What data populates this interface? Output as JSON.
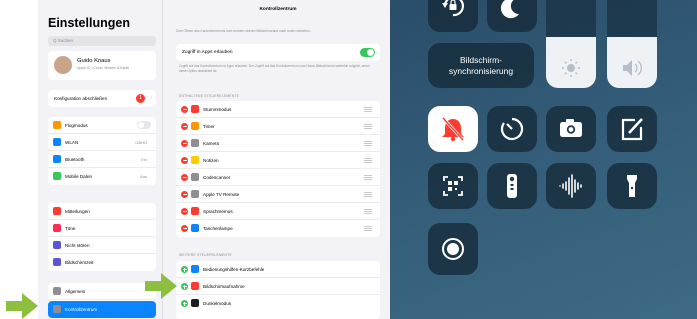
{
  "sidebar": {
    "title": "Einstellungen",
    "search_placeholder": "Q Suchen",
    "profile": {
      "name": "Guido Knaus",
      "subtitle": "Apple-ID, iCloud, Medien & Käufe"
    },
    "config": {
      "label": "Konfiguration abschließen",
      "badge": "1"
    },
    "group1": [
      {
        "label": "Flugmodus",
        "value": "",
        "color": "#ff9500"
      },
      {
        "label": "WLAN",
        "value": "GBHO",
        "color": "#0a84ff"
      },
      {
        "label": "Bluetooth",
        "value": "Ein",
        "color": "#0a84ff"
      },
      {
        "label": "Mobile Daten",
        "value": "Aus",
        "color": "#34c759"
      }
    ],
    "group2": [
      {
        "label": "Mitteilungen",
        "color": "#ff3b30"
      },
      {
        "label": "Töne",
        "color": "#ff2d55"
      },
      {
        "label": "Nicht stören",
        "color": "#5856d6"
      },
      {
        "label": "Bildschirmzeit",
        "color": "#5856d6"
      }
    ],
    "group3": [
      {
        "label": "Allgemein",
        "color": "#8e8e93"
      },
      {
        "label": "Kontrollzentrum",
        "color": "#8e8e93"
      }
    ]
  },
  "detail": {
    "title": "Kontrollzentrum",
    "description": "Zum Öffnen des Kontrollzentrums vom rechten oberen Bildschirmrand nach unten streichen.",
    "access_label": "Zugriff in Apps erlauben",
    "access_desc": "Zugriff auf das Kontrollzentrum in Apps erlauben. Der Zugriff auf das Kontrollzentrum vom Home-Bildschirm ist weiterhin möglich, wenn diese Option deaktiviert ist.",
    "included_header": "ENTHALTENE STEUERELEMENTE",
    "included": [
      {
        "label": "Stummmodus",
        "color": "#ff3b30"
      },
      {
        "label": "Timer",
        "color": "#ff9500"
      },
      {
        "label": "Kamera",
        "color": "#8e8e93"
      },
      {
        "label": "Notizen",
        "color": "#ffcc00"
      },
      {
        "label": "Codescanner",
        "color": "#8e8e93"
      },
      {
        "label": "Apple TV Remote",
        "color": "#8e8e93"
      },
      {
        "label": "Sprachmemos",
        "color": "#ff3b30"
      },
      {
        "label": "Taschenlampe",
        "color": "#0a84ff"
      }
    ],
    "more_header": "WEITERE STEUERELEMENTE",
    "more": [
      {
        "label": "Bedienungshilfen-Kurzbefehle",
        "color": "#0a84ff"
      },
      {
        "label": "Bildschirmaufnahme",
        "color": "#ff3b30"
      },
      {
        "label": "Dunkelmodus",
        "color": "#1c1c1e"
      }
    ]
  },
  "control_center": {
    "sync_label": "Bildschirm-\nsynchronisierung",
    "brightness_level": 0.5,
    "volume_level": 0.5
  },
  "colors": {
    "arrow": "#8cbf3f",
    "selected": "#0a84ff",
    "toggle_on": "#34c759"
  }
}
